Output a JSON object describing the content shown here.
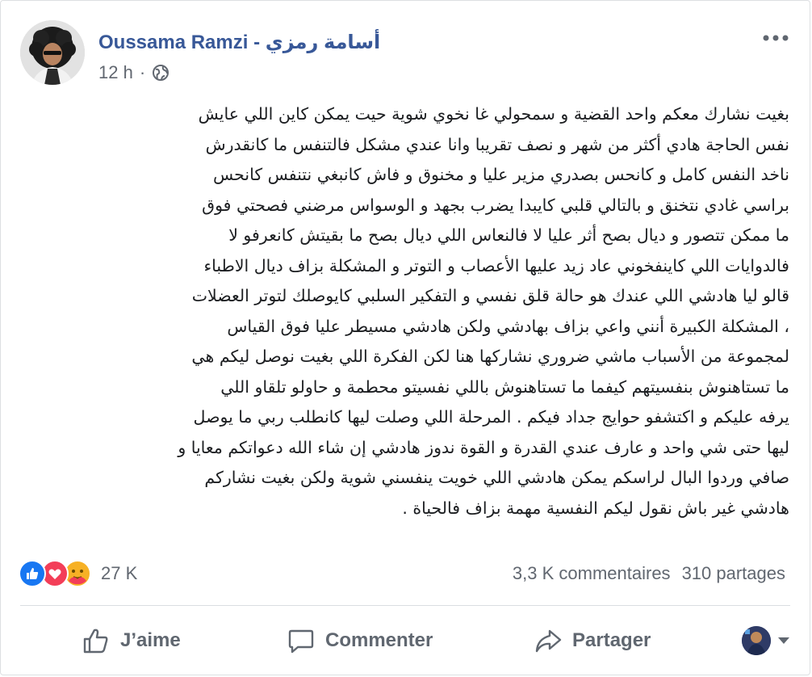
{
  "post": {
    "author": "Oussama Ramzi - أسامة رمزي",
    "time": "12 h",
    "separator": "·",
    "privacy_icon": "globe-icon",
    "more_icon": "more-options-icon",
    "body_lines": [
      "بغيت نشارك معكم واحد القضية و سمحولي غا نخوي شوية حيت يمكن كاين اللي عايش",
      "نفس الحاجة هادي أكثر من شهر و نصف تقريبا وانا عندي مشكل فالتنفس ما كانقدرش",
      "ناخد النفس كامل و كانحس بصدري مزير عليا و مخنوق و فاش كانبغي نتنفس كانحس",
      "براسي غادي نتخنق و بالتالي قلبي كايبدا يضرب بجهد و الوسواس مرضني فصحتي فوق",
      "ما ممكن تتصور و ديال بصح أثر عليا لا فالنعاس اللي ديال بصح ما بقيتش كانعرفو لا",
      "فالدوايات اللي كاينفخوني عاد زيد عليها الأعصاب و التوتر و المشكلة بزاف ديال الاطباء",
      "قالو ليا هادشي اللي عندك هو حالة قلق نفسي و التفكير السلبي كايوصلك لتوتر العضلات",
      "، المشكلة الكبيرة أنني واعي بزاف بهادشي ولكن هادشي مسيطر عليا فوق القياس",
      "لمجموعة من الأسباب ماشي ضروري نشاركها هنا لكن الفكرة اللي بغيت نوصل ليكم هي",
      "ما تستاهنوش بنفسيتهم كيفما ما تستاهنوش باللي نفسيتو محطمة و حاولو تلقاو اللي",
      "يرفه عليكم و اكتشفو حوايج جداد فيكم . المرحلة اللي وصلت ليها كانطلب ربي ما يوصل",
      "ليها حتى شي واحد و عارف عندي القدرة و القوة ندوز هادشي إن شاء الله دعواتكم معايا و",
      "صافي وردوا البال لراسكم يمكن هادشي اللي خويت ينفسني شوية ولكن بغيت نشاركم",
      "هادشي غير باش نقول ليكم النفسية مهمة بزاف فالحياة ."
    ]
  },
  "stats": {
    "reaction_icons": [
      "like-reaction-icon",
      "love-reaction-icon",
      "care-reaction-icon"
    ],
    "reactions_count": "27 K",
    "comments": "3,3 K commentaires",
    "shares": "310 partages"
  },
  "actions": {
    "like": "J’aime",
    "comment": "Commenter",
    "share": "Partager"
  },
  "colors": {
    "author": "#385898",
    "text": "#1c1e21",
    "muted": "#616770",
    "like_blue": "#1877f2",
    "love_red": "#f33e58",
    "care_yellow": "#f7b125",
    "divider": "#dadde1"
  }
}
